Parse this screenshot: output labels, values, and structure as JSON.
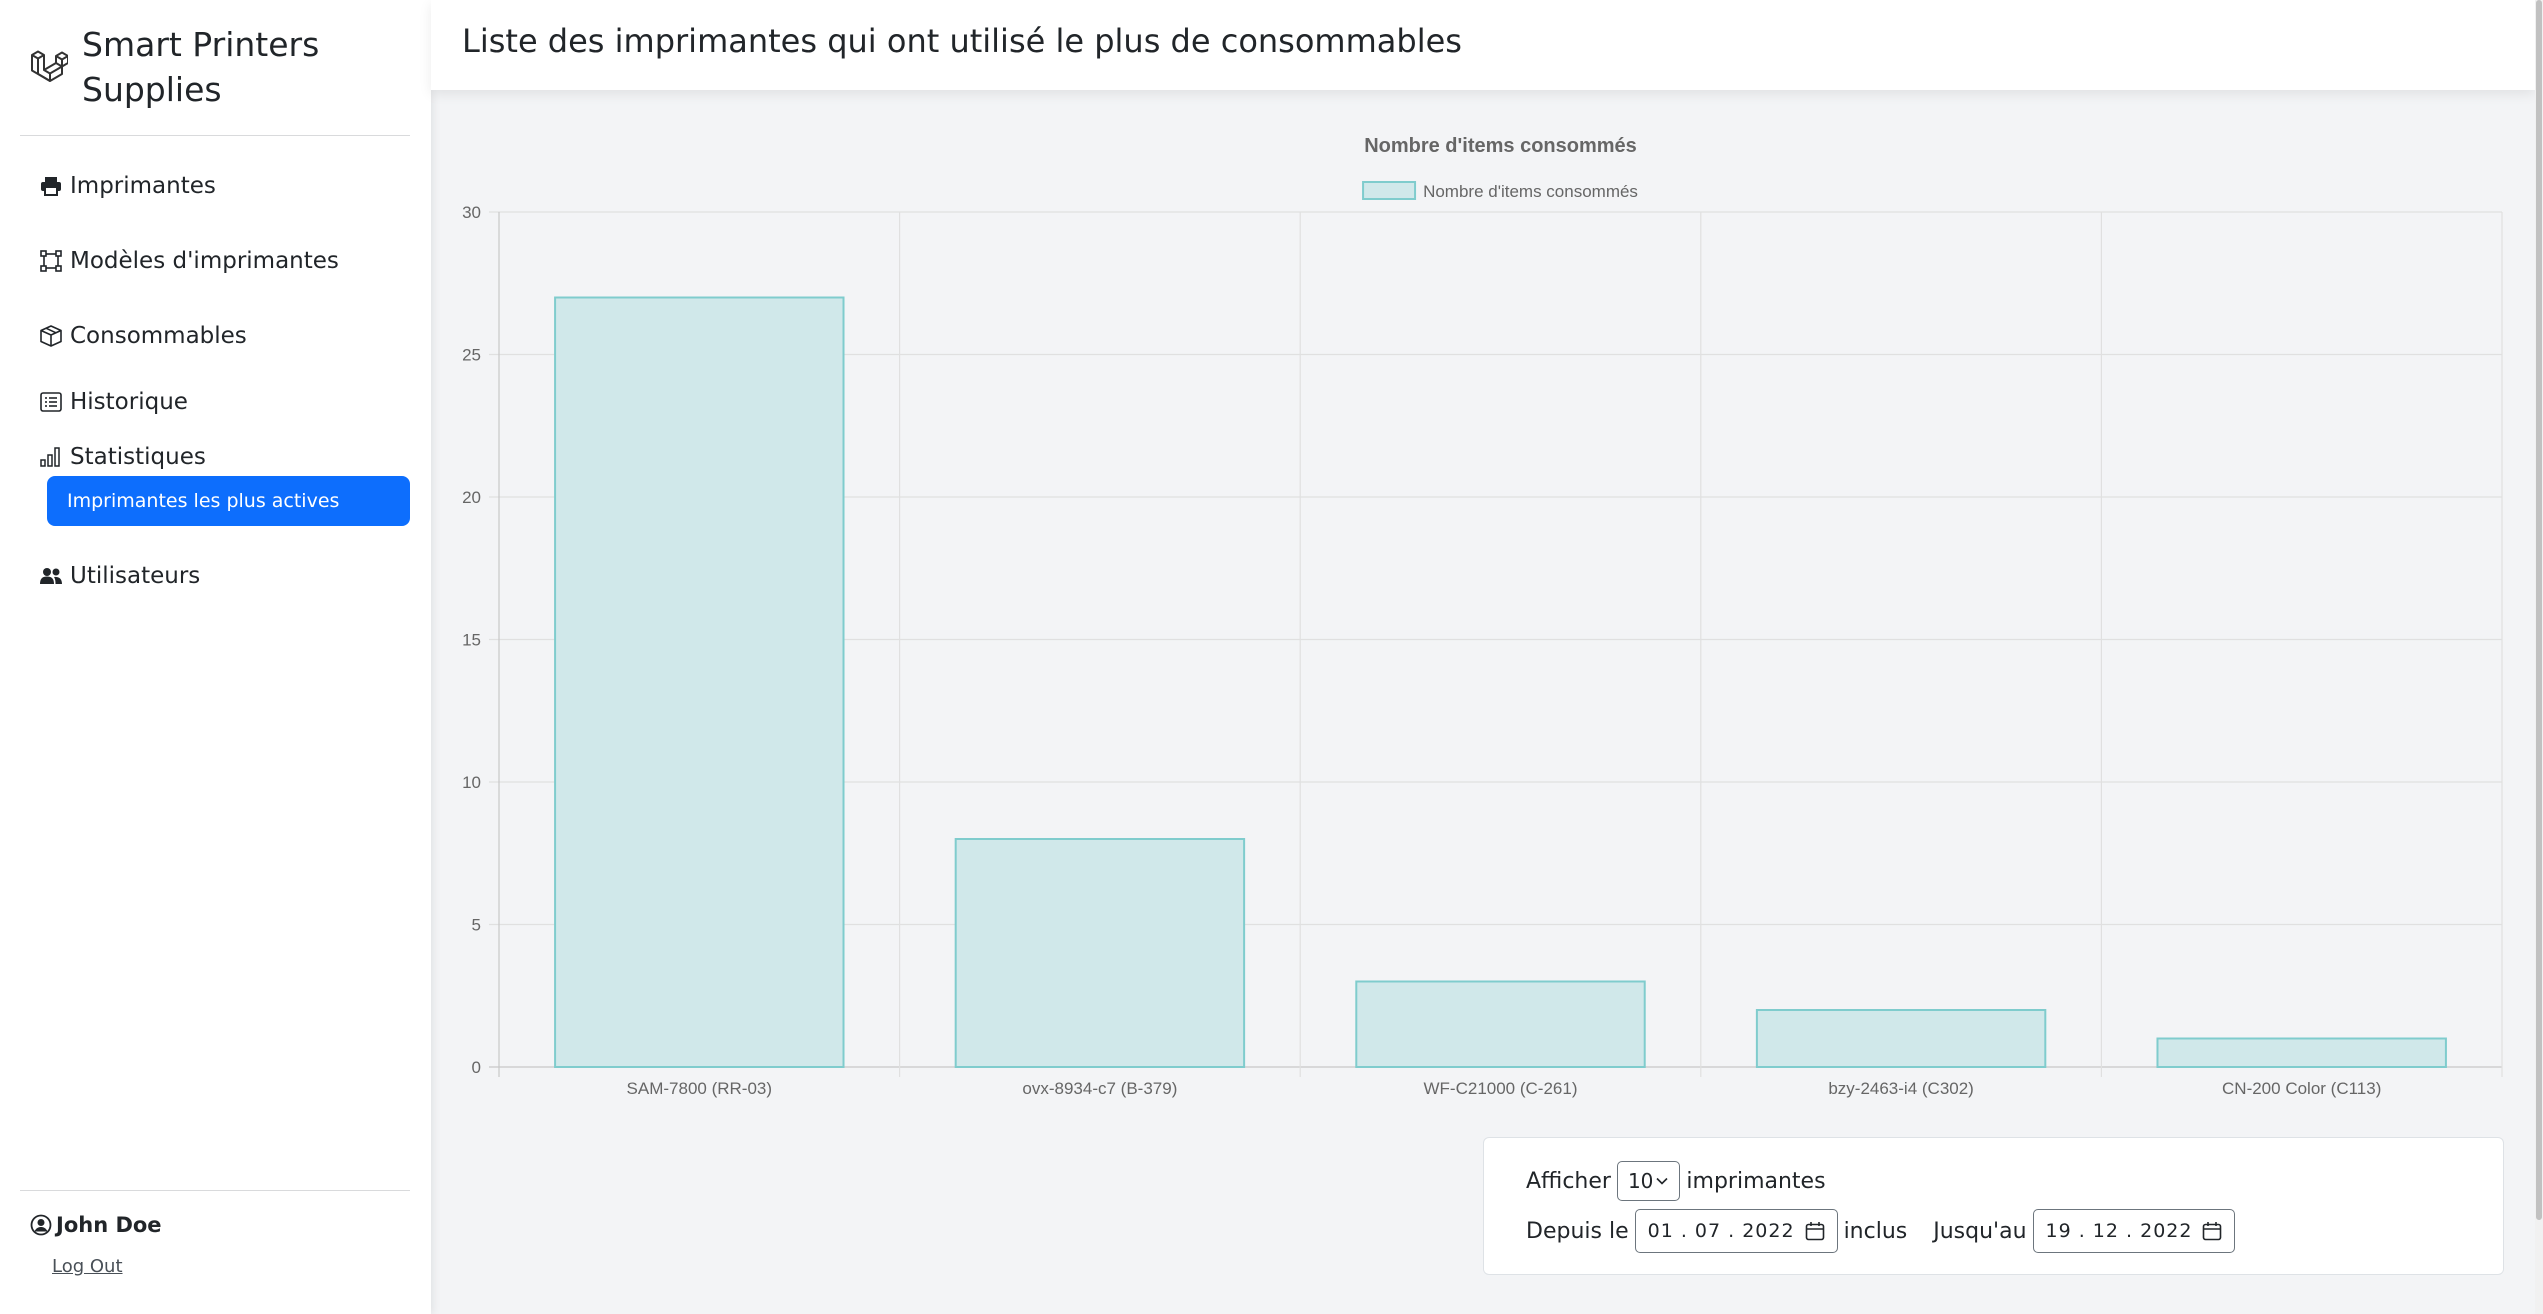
{
  "sidebar": {
    "brand": "Smart Printers Supplies",
    "brand_line1": "Smart Printers",
    "brand_line2": "Supplies",
    "items": [
      {
        "label": "Imprimantes",
        "icon": "printer-icon"
      },
      {
        "label": "Modèles d'imprimantes",
        "icon": "bounding-box-icon"
      },
      {
        "label": "Consommables",
        "icon": "box-icon"
      },
      {
        "label": "Historique",
        "icon": "list-icon"
      },
      {
        "label": "Statistiques",
        "icon": "bar-chart-icon"
      },
      {
        "label": "Utilisateurs",
        "icon": "people-icon"
      }
    ],
    "active_subitem": "Imprimantes les plus actives",
    "user_name": "John Doe",
    "logout_label": "Log Out"
  },
  "header": {
    "title": "Liste des imprimantes qui ont utilisé le plus de consommables"
  },
  "filters": {
    "show_label": "Afficher",
    "show_value": "10",
    "show_suffix": "imprimantes",
    "from_label": "Depuis le",
    "from_value": "01 . 07 . 2022",
    "from_suffix": "inclus",
    "to_label": "Jusqu'au",
    "to_value": "19 . 12 . 2022"
  },
  "colors": {
    "accent": "#0d6efd",
    "bar_fill": "#d0e8ea",
    "bar_stroke": "#7fcccd"
  },
  "chart_data": {
    "type": "bar",
    "title": "Nombre d'items consommés",
    "legend_position": "top",
    "categories": [
      "SAM-7800 (RR-03)",
      "ovx-8934-c7 (B-379)",
      "WF-C21000 (C-261)",
      "bzy-2463-i4 (C302)",
      "CN-200 Color (C113)"
    ],
    "series": [
      {
        "name": "Nombre d'items consommés",
        "values": [
          27,
          8,
          3,
          2,
          1
        ]
      }
    ],
    "ylim": [
      0,
      30
    ],
    "yticks": [
      0,
      5,
      10,
      15,
      20,
      25,
      30
    ],
    "grid": true
  }
}
